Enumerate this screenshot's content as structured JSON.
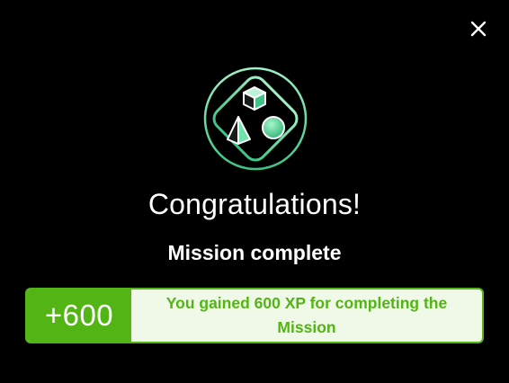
{
  "dialog": {
    "close_icon": "close-icon",
    "badge_icon": "geometric-shapes-badge-icon",
    "title": "Congratulations!",
    "subtitle": "Mission complete",
    "xp": {
      "amount": "+600",
      "message": "You gained 600 XP for completing the Mission"
    }
  },
  "colors": {
    "background": "#000000",
    "accent_green": "#52b515",
    "light_green_bg": "#f0f8e7",
    "badge_mint": "#6fe3ab",
    "text_white": "#ffffff"
  }
}
